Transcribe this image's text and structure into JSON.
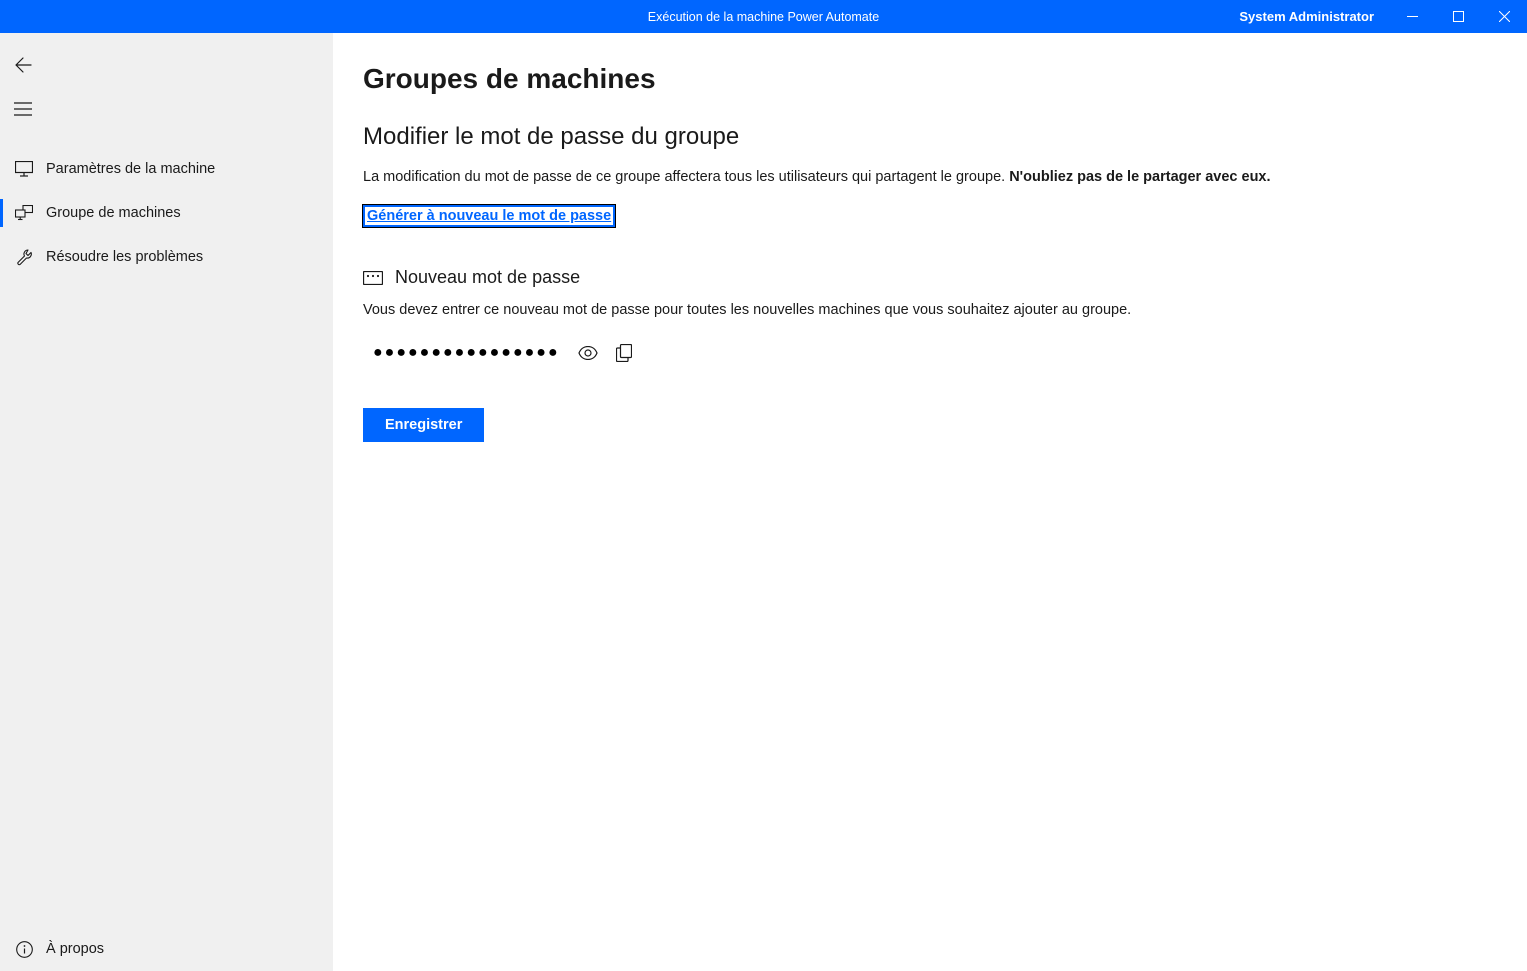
{
  "titlebar": {
    "title": "Exécution de la machine Power Automate",
    "user": "System Administrator"
  },
  "sidebar": {
    "items": [
      {
        "label": "Paramètres de la machine"
      },
      {
        "label": "Groupe de machines"
      },
      {
        "label": "Résoudre les problèmes"
      }
    ],
    "about": "À propos"
  },
  "main": {
    "page_title": "Groupes de machines",
    "section_title": "Modifier le mot de passe du groupe",
    "section_desc_text": "La modification du mot de passe de ce groupe affectera tous les utilisateurs qui partagent le groupe. ",
    "section_desc_strong": "N'oubliez pas de le partager avec eux.",
    "regen_link": "Générer à nouveau le mot de passe",
    "subsection_title": "Nouveau mot de passe",
    "subsection_desc": "Vous devez entrer ce nouveau mot de passe pour toutes les nouvelles machines que vous souhaitez ajouter au groupe.",
    "password_masked": "●●●●●●●●●●●●●●●●",
    "save_label": "Enregistrer"
  }
}
